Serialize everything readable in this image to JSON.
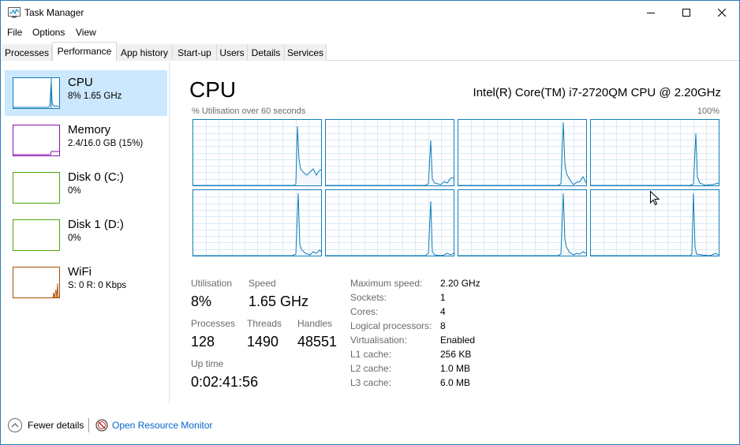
{
  "window": {
    "title": "Task Manager",
    "icon": "task-manager-icon"
  },
  "menu": [
    "File",
    "Options",
    "View"
  ],
  "tabs": [
    "Processes",
    "Performance",
    "App history",
    "Start-up",
    "Users",
    "Details",
    "Services"
  ],
  "active_tab": "Performance",
  "sidebar": {
    "items": [
      {
        "name": "CPU",
        "sub": "8%  1.65 GHz",
        "color": "#117dbb",
        "selected": true
      },
      {
        "name": "Memory",
        "sub": "2.4/16.0 GB (15%)",
        "color": "#8b12ae",
        "selected": false
      },
      {
        "name": "Disk 0 (C:)",
        "sub": "0%",
        "color": "#4da60c",
        "selected": false
      },
      {
        "name": "Disk 1 (D:)",
        "sub": "0%",
        "color": "#4da60c",
        "selected": false
      },
      {
        "name": "WiFi",
        "sub": "S: 0 R: 0 Kbps",
        "color": "#a74f01",
        "selected": false
      }
    ]
  },
  "main": {
    "title": "CPU",
    "model": "Intel(R) Core(TM) i7-2720QM CPU @ 2.20GHz",
    "graph_caption": "% Utilisation over 60 seconds",
    "graph_max": "100%",
    "graph_color": "#117dbb",
    "grid_color": "#d9eaf4",
    "core_count": 8
  },
  "stats": {
    "utilisation_label": "Utilisation",
    "utilisation_value": "8%",
    "speed_label": "Speed",
    "speed_value": "1.65 GHz",
    "processes_label": "Processes",
    "processes_value": "128",
    "threads_label": "Threads",
    "threads_value": "1490",
    "handles_label": "Handles",
    "handles_value": "48551",
    "uptime_label": "Up time",
    "uptime_value": "0:02:41:56"
  },
  "info": [
    {
      "label": "Maximum speed:",
      "value": "2.20 GHz"
    },
    {
      "label": "Sockets:",
      "value": "1"
    },
    {
      "label": "Cores:",
      "value": "4"
    },
    {
      "label": "Logical processors:",
      "value": "8"
    },
    {
      "label": "Virtualisation:",
      "value": "Enabled"
    },
    {
      "label": "L1 cache:",
      "value": "256 KB"
    },
    {
      "label": "L2 cache:",
      "value": "1.0 MB"
    },
    {
      "label": "L3 cache:",
      "value": "6.0 MB"
    }
  ],
  "footer": {
    "fewer_details": "Fewer details",
    "open_monitor": "Open Resource Monitor"
  }
}
